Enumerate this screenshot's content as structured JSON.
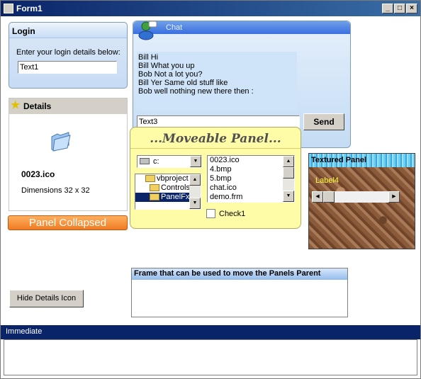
{
  "window": {
    "title": "Form1"
  },
  "login": {
    "title": "Login",
    "prompt": "Enter your login details below:",
    "field_value": "Text1"
  },
  "details": {
    "title": "Details",
    "filename": "0023.ico",
    "dimensions": "Dimensions 32 x 32"
  },
  "collapsed_panel": {
    "label": "Panel Collapsed"
  },
  "chat": {
    "title": "Chat",
    "messages": [
      "Bill Hi",
      "Bill What you up",
      "Bob Not a lot you?",
      "Bill Yer Same old stuff like",
      "Bob well nothing new there then :"
    ],
    "input_value": "Text3",
    "send_label": "Send"
  },
  "moveable": {
    "title": "...Moveable Panel...",
    "drive": "c:",
    "folders": [
      "vbproject",
      "Controls",
      "PanelFx"
    ],
    "files": [
      "0023.ico",
      "4.bmp",
      "5.bmp",
      "chat.ico",
      "demo.frm"
    ],
    "checkbox_label": "Check1"
  },
  "textured": {
    "title": "Textured Panel",
    "label": "Label4"
  },
  "frame": {
    "title": "Frame that can be used to move the Panels Parent"
  },
  "hide_button": {
    "label": "Hide Details Icon"
  },
  "immediate": {
    "title": "Immediate"
  }
}
